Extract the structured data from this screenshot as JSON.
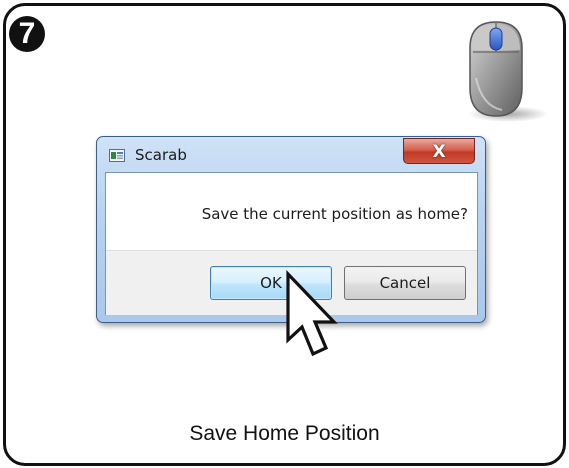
{
  "step": {
    "number": "7"
  },
  "dialog": {
    "title": "Scarab",
    "close_label": "X",
    "message": "Save the current position as home?",
    "ok_label": "OK",
    "cancel_label": "Cancel"
  },
  "caption": "Save Home Position",
  "icons": {
    "step_badge": "numbered-circle",
    "mouse": "mouse-left-click-icon",
    "app": "window-app-icon",
    "cursor": "arrow-pointer-icon"
  },
  "colors": {
    "border": "#111111",
    "dialog_frame": "#aac8ec",
    "close_button": "#c03a26",
    "ok_button": "#bee6fd",
    "mouse_button_highlight": "#3a6fd8"
  }
}
